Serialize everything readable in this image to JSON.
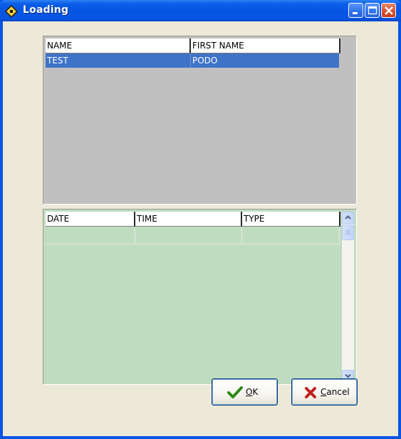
{
  "window": {
    "title": "Loading",
    "controls": [
      "minimize-icon",
      "maximize-icon",
      "close-icon"
    ]
  },
  "grid_top": {
    "columns": [
      "NAME",
      "FIRST NAME"
    ],
    "rows": [
      [
        "TEST",
        "PODO"
      ]
    ],
    "selected_row": 0
  },
  "grid_bottom": {
    "columns": [
      "DATE",
      "TIME",
      "TYPE"
    ],
    "rows": [
      [
        "",
        "",
        ""
      ]
    ]
  },
  "buttons": {
    "ok": {
      "first": "O",
      "rest": "K",
      "icon": "checkmark-icon"
    },
    "cancel": {
      "first": "C",
      "rest": "ancel",
      "icon": "x-icon"
    }
  },
  "colors": {
    "titlebar": "#0a55e6",
    "client_bg": "#ece9d8",
    "grid_top_bg": "#c0c0c0",
    "grid_bottom_bg": "#c0dcc0",
    "selection": "#3e73c8"
  }
}
